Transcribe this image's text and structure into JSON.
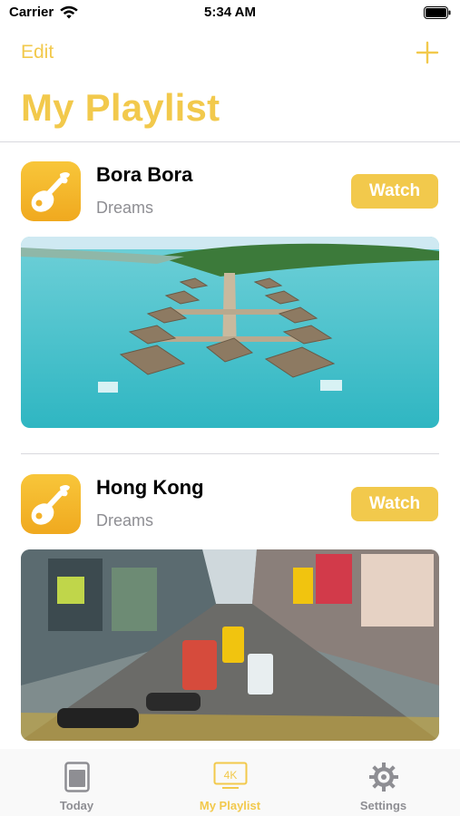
{
  "status_bar": {
    "carrier": "Carrier",
    "time": "5:34 AM",
    "wifi_icon": "wifi-icon",
    "battery_icon": "battery-icon"
  },
  "nav": {
    "edit_label": "Edit",
    "add_icon": "plus-icon"
  },
  "page": {
    "title": "My Playlist"
  },
  "playlist": [
    {
      "title": "Bora Bora",
      "subtitle": "Dreams",
      "button_label": "Watch",
      "icon": "guitar-icon",
      "image": "overwater-bungalows-image"
    },
    {
      "title": "Hong Kong",
      "subtitle": "Dreams",
      "button_label": "Watch",
      "icon": "guitar-icon",
      "image": "city-street-image"
    }
  ],
  "tab_bar": {
    "tabs": [
      {
        "label": "Today",
        "icon": "today-icon"
      },
      {
        "label": "My Playlist",
        "icon": "4k-icon",
        "badge": "4K",
        "active": true
      },
      {
        "label": "Settings",
        "icon": "gear-icon"
      }
    ]
  },
  "colors": {
    "accent": "#f2c94c",
    "secondary_text": "#8e8e93"
  }
}
